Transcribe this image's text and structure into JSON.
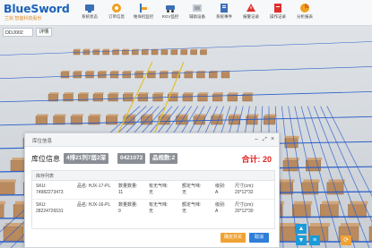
{
  "brand": {
    "title": "BlueSword",
    "subtitle": "兰剑 智能科技股份"
  },
  "nav": {
    "items": [
      {
        "label": "系统状态",
        "icon": "monitor-icon",
        "color": "#3b6fb6"
      },
      {
        "label": "订单信息",
        "icon": "order-icon",
        "color": "#f0a020"
      },
      {
        "label": "堆垛机监控",
        "icon": "stacker-icon",
        "color": "#3b6fb6"
      },
      {
        "label": "RGV监控",
        "icon": "rgv-icon",
        "color": "#3b6fb6"
      },
      {
        "label": "辅助设备",
        "icon": "equipment-icon",
        "color": "#9aa3ad"
      },
      {
        "label": "系统事件",
        "icon": "event-icon",
        "color": "#3b6fb6"
      },
      {
        "label": "报警记录",
        "icon": "alarm-icon",
        "color": "#e03030"
      },
      {
        "label": "操作记录",
        "icon": "operation-icon",
        "color": "#e03030"
      },
      {
        "label": "分析报表",
        "icon": "report-icon",
        "color": "#f0a020"
      }
    ]
  },
  "toolbar": {
    "select_value": "DDJ002",
    "select_button": "详情"
  },
  "dialog": {
    "title": "库位信息",
    "info_label": "库位信息",
    "location_tag": "4排21列7层2深",
    "code_tag": "0421072",
    "count_tag": "品规数:2",
    "total": "合计: 20",
    "list_title": "库存列表",
    "rows": [
      {
        "sku_label": "SKU:",
        "sku": "74982273473",
        "name_label": "品名:",
        "name": "HJX-17-PL",
        "qty_label": "数量数量:",
        "qty": "11",
        "ex1_label": "有无气味:",
        "ex1": "无",
        "ex2_label": "额定气味:",
        "ex2": "无",
        "grade_label": "级别:",
        "grade": "A",
        "size_label": "尺寸(cm):",
        "size": "20*12*32"
      },
      {
        "sku_label": "SKU:",
        "sku": "28224726531",
        "name_label": "品名:",
        "name": "HJX-16-PL",
        "qty_label": "数量数量:",
        "qty": "9",
        "ex1_label": "有无气味:",
        "ex1": "无",
        "ex2_label": "额定气味:",
        "ex2": "无",
        "grade_label": "级别:",
        "grade": "A",
        "size_label": "尺寸(cm):",
        "size": "20*12*30"
      }
    ],
    "btn_primary": "确定并关",
    "btn_close": "取消"
  },
  "colors": {
    "accent": "#1c63b7",
    "total": "#e02020",
    "rack": "#2c5fc9",
    "box": "#b98a5e"
  }
}
